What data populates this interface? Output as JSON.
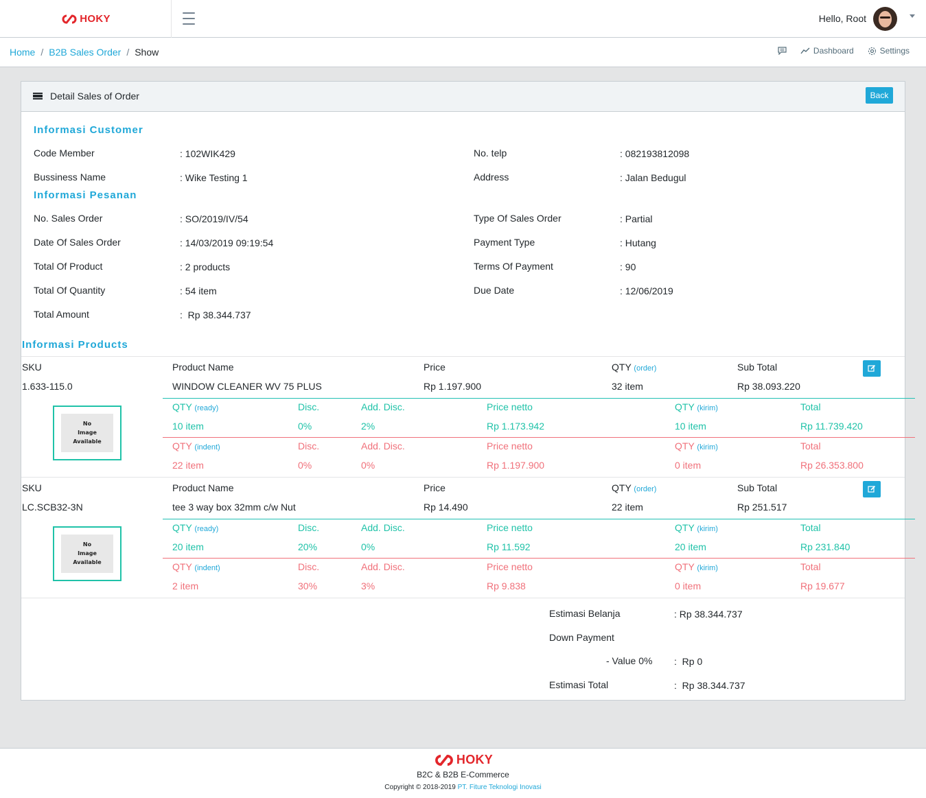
{
  "header": {
    "brand": "HOKY",
    "hello": "Hello, Root"
  },
  "breadcrumb": {
    "home": "Home",
    "sep": "/",
    "parent": "B2B Sales Order",
    "current": "Show"
  },
  "bread_menu": {
    "dashboard": "Dashboard",
    "settings": "Settings"
  },
  "card": {
    "title": "Detail Sales of Order",
    "back_label": "Back"
  },
  "customer": {
    "section_title": "Informasi Customer",
    "code_member_label": "Code Member",
    "code_member": ": 102WIK429",
    "business_name_label": "Bussiness Name",
    "business_name": ": Wike Testing 1",
    "telp_label": "No. telp",
    "telp": ": 082193812098",
    "address_label": "Address",
    "address": ": Jalan Bedugul"
  },
  "order": {
    "section_title": "Informasi Pesanan",
    "no_label": "No. Sales Order",
    "no": ": SO/2019/IV/54",
    "date_label": "Date Of Sales Order",
    "date": ": 14/03/2019 09:19:54",
    "total_product_label": "Total Of Product",
    "total_product": ": 2 products",
    "total_qty_label": "Total Of Quantity",
    "total_qty": ": 54 item",
    "total_amount_label": "Total Amount",
    "total_amount": ":  Rp 38.344.737",
    "type_label": "Type Of Sales Order",
    "type": ": Partial",
    "payment_label": "Payment Type",
    "payment": ": Hutang",
    "terms_label": "Terms Of Payment",
    "terms": ": 90",
    "due_label": "Due Date",
    "due": ": 12/06/2019"
  },
  "products_section_title": "Informasi Products",
  "labels": {
    "sku": "SKU",
    "product_name": "Product Name",
    "price": "Price",
    "qty": "QTY",
    "order": "(order)",
    "ready": "(ready)",
    "indent": "(indent)",
    "kirim": "(kirim)",
    "sub_total": "Sub Total",
    "disc": "Disc.",
    "add_disc": "Add. Disc.",
    "price_netto": "Price netto",
    "total": "Total",
    "no_image": [
      "No",
      "Image",
      "Available"
    ]
  },
  "products": [
    {
      "sku": "1.633-115.0",
      "name": "WINDOW CLEANER WV 75 PLUS",
      "price": "Rp 1.197.900",
      "qty": "32 item",
      "sub_total": "Rp 38.093.220",
      "ready": {
        "qty": "10 item",
        "disc": "0%",
        "add_disc": "2%",
        "netto": "Rp 1.173.942",
        "kirim": "10 item",
        "total": "Rp 11.739.420"
      },
      "indent": {
        "qty": "22 item",
        "disc": "0%",
        "add_disc": "0%",
        "netto": "Rp 1.197.900",
        "kirim": "0 item",
        "total": "Rp 26.353.800"
      }
    },
    {
      "sku": "LC.SCB32-3N",
      "name": "tee 3 way box 32mm c/w Nut",
      "price": "Rp 14.490",
      "qty": "22 item",
      "sub_total": "Rp 251.517",
      "ready": {
        "qty": "20 item",
        "disc": "20%",
        "add_disc": "0%",
        "netto": "Rp 11.592",
        "kirim": "20 item",
        "total": "Rp 231.840"
      },
      "indent": {
        "qty": "2 item",
        "disc": "30%",
        "add_disc": "3%",
        "netto": "Rp 9.838",
        "kirim": "0 item",
        "total": "Rp 19.677"
      }
    }
  ],
  "summary": {
    "estimasi_belanja_label": "Estimasi Belanja",
    "estimasi_belanja": ": Rp 38.344.737",
    "down_payment_label": "Down Payment",
    "value_label": "- Value 0%",
    "value": ":  Rp 0",
    "estimasi_total_label": "Estimasi Total",
    "estimasi_total": ":  Rp 38.344.737"
  },
  "footer": {
    "brand": "HOKY",
    "subtitle": "B2C & B2B E-Commerce",
    "copyright": "Copyright © 2018-2019 ",
    "company": "PT. Fiture Teknologi Inovasi"
  },
  "colors": {
    "accent": "#20a8d8",
    "ready": "#1fc2a8",
    "indent": "#f0707a",
    "brand": "#e3262b"
  }
}
